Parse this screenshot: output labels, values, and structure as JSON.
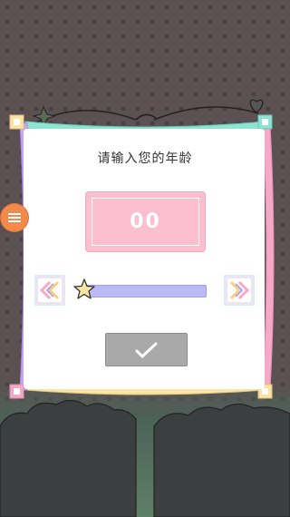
{
  "dialog": {
    "prompt": "请输入您的年龄",
    "age_value": "00"
  },
  "slider": {
    "level": 0
  },
  "icons": {
    "menu": "menu-icon",
    "decrease": "double-chevron-left-icon",
    "increase": "double-chevron-right-icon",
    "confirm": "checkmark-icon",
    "thumb": "star-icon"
  },
  "colors": {
    "accent_pink": "#fbbfd0",
    "slider_track": "#b9b9f3",
    "confirm_button": "#a9a9a9",
    "menu_button": "#f28a4b",
    "frame_mint": "#8fe3d2",
    "frame_purple": "#c7a6f2",
    "frame_yellow": "#fbe3a3"
  }
}
